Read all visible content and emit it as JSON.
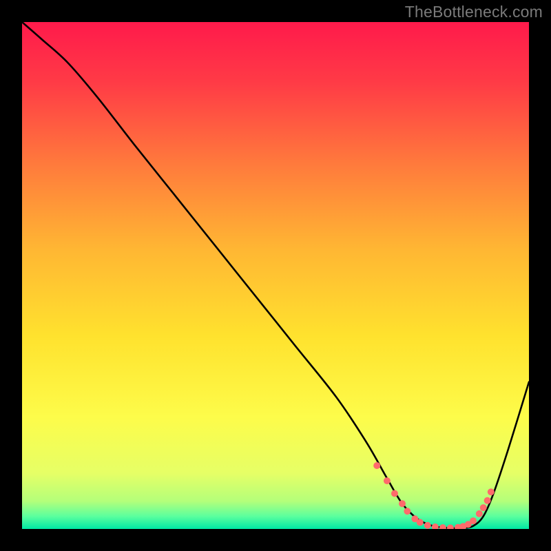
{
  "watermark": "TheBottleneck.com",
  "chart_data": {
    "type": "line",
    "title": "",
    "xlabel": "",
    "ylabel": "",
    "xlim": [
      0,
      100
    ],
    "ylim": [
      0,
      100
    ],
    "gradient_stops": [
      {
        "offset": 0.0,
        "color": "#ff1a4b"
      },
      {
        "offset": 0.12,
        "color": "#ff3b46"
      },
      {
        "offset": 0.28,
        "color": "#ff7a3c"
      },
      {
        "offset": 0.45,
        "color": "#ffb733"
      },
      {
        "offset": 0.62,
        "color": "#ffe22e"
      },
      {
        "offset": 0.78,
        "color": "#fdfc4a"
      },
      {
        "offset": 0.89,
        "color": "#e6ff66"
      },
      {
        "offset": 0.945,
        "color": "#b4ff7a"
      },
      {
        "offset": 0.975,
        "color": "#5bff9e"
      },
      {
        "offset": 1.0,
        "color": "#00e8a4"
      }
    ],
    "series": [
      {
        "name": "curve",
        "color": "#000000",
        "x": [
          0,
          4,
          9,
          15,
          22,
          30,
          38,
          46,
          54,
          62,
          68,
          72,
          75,
          78,
          81,
          84,
          87,
          89,
          91,
          93,
          96,
          100
        ],
        "y": [
          100,
          96.5,
          92,
          85,
          76,
          66,
          56,
          46,
          36,
          26,
          17,
          10,
          5,
          2,
          0.6,
          0.2,
          0.2,
          0.6,
          2.5,
          7,
          16,
          29
        ]
      }
    ],
    "markers": {
      "name": "highlight-points",
      "color": "#ff6b6b",
      "radius": 5,
      "points": [
        {
          "x": 70.0,
          "y": 12.5
        },
        {
          "x": 72.0,
          "y": 9.5
        },
        {
          "x": 73.5,
          "y": 7.0
        },
        {
          "x": 75.0,
          "y": 5.0
        },
        {
          "x": 76.0,
          "y": 3.5
        },
        {
          "x": 77.5,
          "y": 2.0
        },
        {
          "x": 78.5,
          "y": 1.3
        },
        {
          "x": 80.0,
          "y": 0.7
        },
        {
          "x": 81.5,
          "y": 0.4
        },
        {
          "x": 83.0,
          "y": 0.25
        },
        {
          "x": 84.5,
          "y": 0.2
        },
        {
          "x": 86.0,
          "y": 0.3
        },
        {
          "x": 87.0,
          "y": 0.5
        },
        {
          "x": 88.0,
          "y": 0.9
        },
        {
          "x": 89.0,
          "y": 1.6
        },
        {
          "x": 90.2,
          "y": 3.0
        },
        {
          "x": 91.0,
          "y": 4.2
        },
        {
          "x": 91.8,
          "y": 5.6
        },
        {
          "x": 92.5,
          "y": 7.3
        }
      ]
    }
  }
}
